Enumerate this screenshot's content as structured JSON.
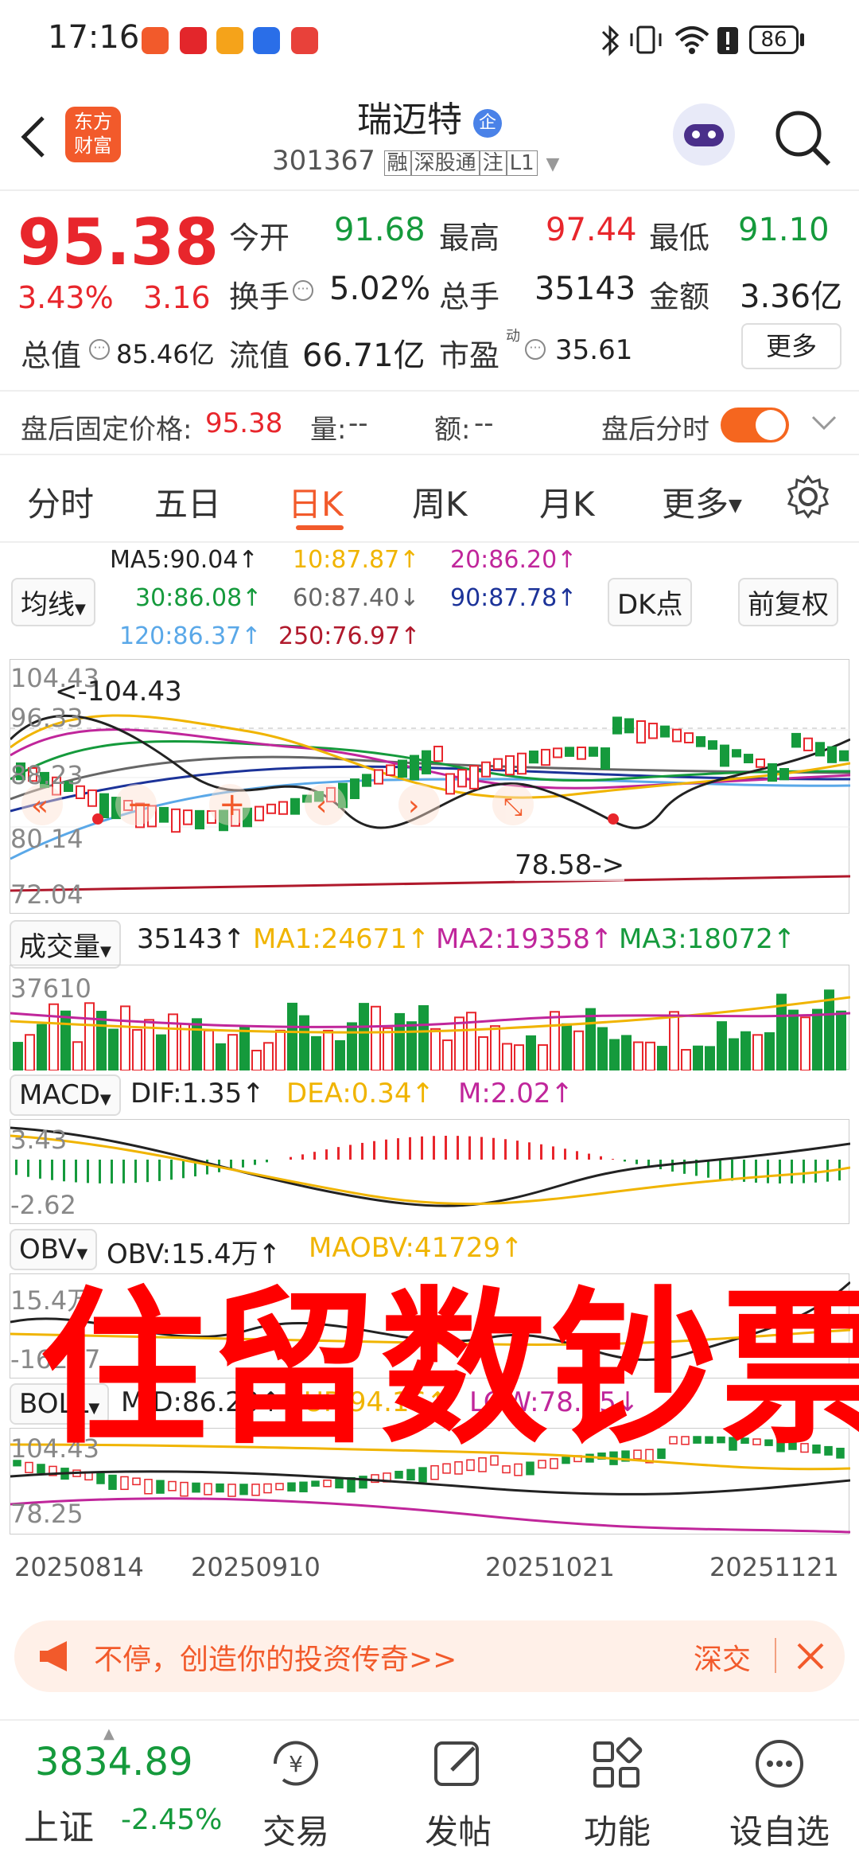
{
  "status": {
    "time": "17:16",
    "battery": "86"
  },
  "header": {
    "stock_name": "瑞迈特",
    "badge": "企",
    "code": "301367",
    "tags": [
      "融",
      "深股通",
      "注",
      "L1"
    ],
    "logo_top": "东方",
    "logo_bottom": "财富"
  },
  "quote": {
    "price": "95.38",
    "change_pct": "3.43%",
    "change": "3.16",
    "open_label": "今开",
    "open": "91.68",
    "high_label": "最高",
    "high": "97.44",
    "low_label": "最低",
    "low": "91.10",
    "turnover_label": "换手",
    "turnover": "5.02%",
    "volume_label": "总手",
    "volume": "35143",
    "amount_label": "金额",
    "amount": "3.36亿",
    "mcap_label": "总值",
    "mcap": "85.46亿",
    "float_label": "流值",
    "float": "66.71亿",
    "pe_label": "市盈",
    "pe_sup": "动",
    "pe": "35.61",
    "more": "更多"
  },
  "afterhours": {
    "label": "盘后固定价格:",
    "price": "95.38",
    "vol_label": "量:",
    "vol": "--",
    "amt_label": "额:",
    "amt": "--",
    "toggle_label": "盘后分时"
  },
  "tabs": [
    "分时",
    "五日",
    "日K",
    "周K",
    "月K",
    "更多"
  ],
  "ma": {
    "selector": "均线",
    "ma5": "MA5:90.04↑",
    "ma10": "10:87.87↑",
    "ma20": "20:86.20↑",
    "ma30": "30:86.08↑",
    "ma60": "60:87.40↓",
    "ma90": "90:87.78↑",
    "ma120": "120:86.37↑",
    "ma250": "250:76.97↑",
    "dk": "DK点",
    "fq": "前复权"
  },
  "kline": {
    "max_label": "104.43",
    "max_pointer": "<-104.43",
    "y1": "96.33",
    "y2": "88.23",
    "y3": "80.14",
    "y4": "72.04",
    "min_pointer": "78.58->"
  },
  "volume": {
    "selector": "成交量",
    "value": "35143↑",
    "ma1": "MA1:24671↑",
    "ma2": "MA2:19358↑",
    "ma3": "MA3:18072↑",
    "y_max": "37610"
  },
  "macd": {
    "selector": "MACD",
    "dif": "DIF:1.35↑",
    "dea": "DEA:0.34↑",
    "m": "M:2.02↑",
    "y_max": "3.43",
    "y_min": "-2.62"
  },
  "obv": {
    "selector": "OBV",
    "obv": "OBV:15.4万↑",
    "maobv": "MAOBV:41729↑",
    "y_max": "15.4万",
    "y_min": "-16267"
  },
  "boll": {
    "selector": "BOLL",
    "mid": "MID:86.20↑",
    "up": "UP:94.16↑",
    "low": "LOW:78.25↓",
    "y_max": "104.43",
    "y_min": "78.25"
  },
  "dates": [
    "20250814",
    "20250910",
    "20251021",
    "20251121"
  ],
  "banner": {
    "text": "不停，创造你的投资传奇>>",
    "tag": "深交"
  },
  "bottomnav": {
    "index_value": "3834.89",
    "index_name": "上证",
    "index_change": "-2.45%",
    "items": [
      "交易",
      "发帖",
      "功能",
      "设自选"
    ]
  },
  "watermark": "住留数钞票"
}
